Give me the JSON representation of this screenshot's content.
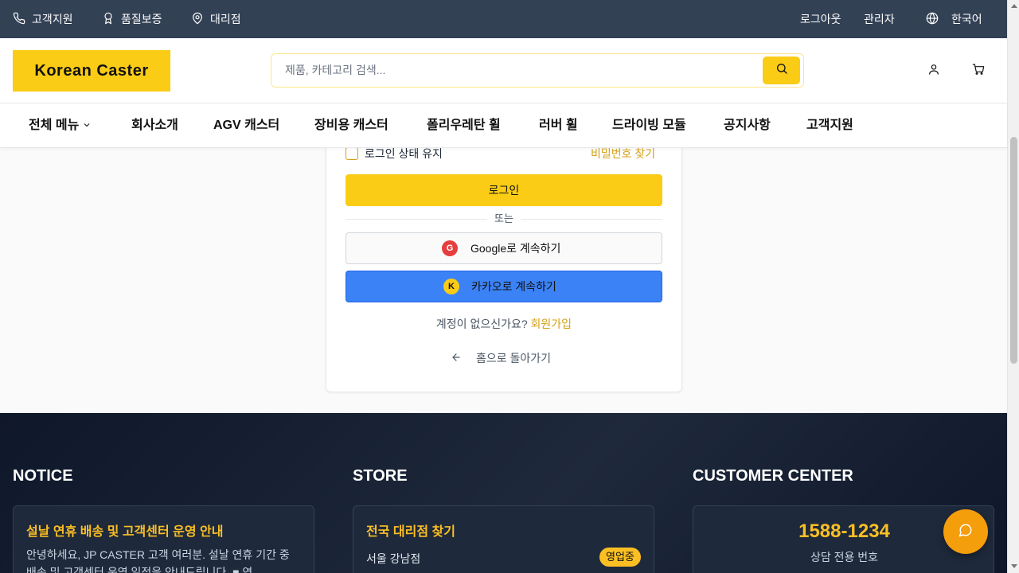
{
  "topbar": {
    "support": "고객지원",
    "quality": "품질보증",
    "dealer": "대리점",
    "logout": "로그아웃",
    "admin": "관리자",
    "language": "한국어"
  },
  "header": {
    "logo": "Korean Caster",
    "search_placeholder": "제품, 카테고리 검색..."
  },
  "nav": {
    "items": [
      "전체 메뉴",
      "회사소개",
      "AGV 캐스터",
      "장비용 캐스터",
      "폴리우레탄 휠",
      "러버 휠",
      "드라이빙 모듈",
      "공지사항",
      "고객지원"
    ]
  },
  "login": {
    "remember": "로그인 상태 유지",
    "forgot": "비밀번호 찾기",
    "login_button": "로그인",
    "divider": "또는",
    "google_badge": "G",
    "google_label": "Google로 계속하기",
    "kakao_badge": "K",
    "kakao_label": "카카오로 계속하기",
    "signup_prompt": "계정이 없으신가요?",
    "signup_link": "회원가입",
    "back_home": "홈으로 돌아가기"
  },
  "footer": {
    "notice": {
      "heading": "NOTICE",
      "title": "설날 연휴 배송 및 고객센터 운영 안내",
      "body": "안녕하세요, JP CASTER 고객 여러분. 설날 연휴 기간 중 배송 및 고객센터 운영 일정을 안내드립니다. ■ 연"
    },
    "store": {
      "heading": "STORE",
      "title": "전국 대리점 찾기",
      "branch": "서울 강남점",
      "status": "영업중"
    },
    "customer": {
      "heading": "CUSTOMER CENTER",
      "phone": "1588-1234",
      "phone_desc": "상담 전용 번호"
    }
  },
  "colors": {
    "accent": "#facc15",
    "link": "#d4a017",
    "kakao_button": "#3b82f6",
    "topbar": "#334155",
    "footer": "#0f172a"
  }
}
